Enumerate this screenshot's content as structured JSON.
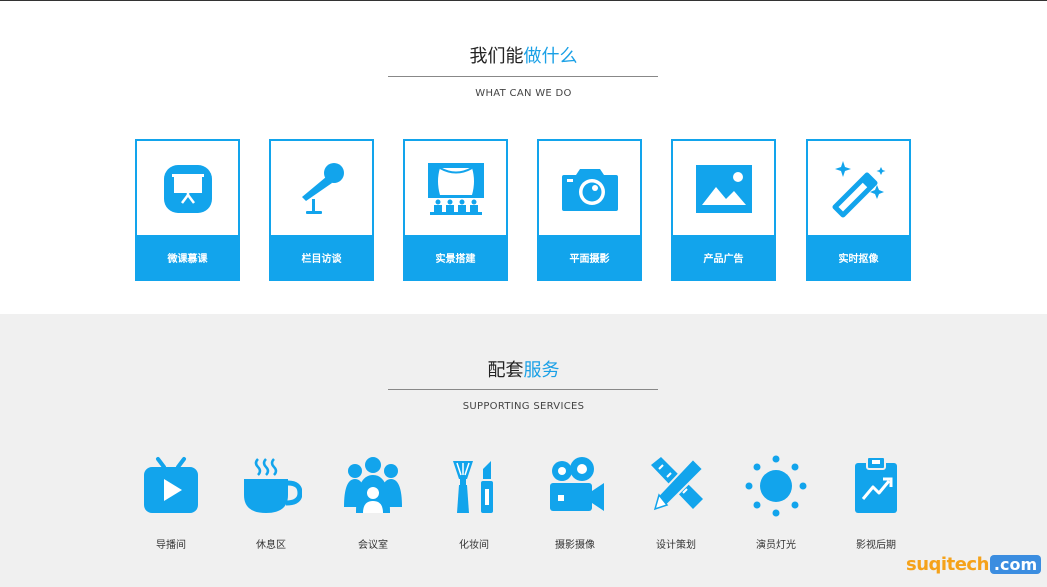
{
  "section1": {
    "title_dark": "我们能",
    "title_highlight": "做什么",
    "subtitle": "WHAT CAN WE DO",
    "cards": [
      {
        "label": "微课慕课",
        "icon": "presentation-icon"
      },
      {
        "label": "栏目访谈",
        "icon": "microphone-icon"
      },
      {
        "label": "实景搭建",
        "icon": "stage-icon"
      },
      {
        "label": "平面摄影",
        "icon": "camera-icon"
      },
      {
        "label": "产品广告",
        "icon": "image-icon"
      },
      {
        "label": "实时抠像",
        "icon": "magic-wand-icon"
      }
    ]
  },
  "section2": {
    "title_dark": "配套",
    "title_highlight": "服务",
    "subtitle": "SUPPORTING SERVICES",
    "services": [
      {
        "label": "导播间",
        "icon": "tv-play-icon"
      },
      {
        "label": "休息区",
        "icon": "coffee-cup-icon"
      },
      {
        "label": "会议室",
        "icon": "meeting-group-icon"
      },
      {
        "label": "化妆间",
        "icon": "makeup-icon"
      },
      {
        "label": "摄影摄像",
        "icon": "video-camera-icon"
      },
      {
        "label": "设计策划",
        "icon": "pencil-ruler-icon"
      },
      {
        "label": "演员灯光",
        "icon": "sun-light-icon"
      },
      {
        "label": "影视后期",
        "icon": "clipboard-chart-icon"
      }
    ]
  },
  "watermark": {
    "part1": "suqitech",
    "part2": ".com"
  },
  "colors": {
    "accent": "#12a4ec",
    "highlight_text": "#1aa0e6",
    "section2_bg": "#f0f0f0"
  }
}
